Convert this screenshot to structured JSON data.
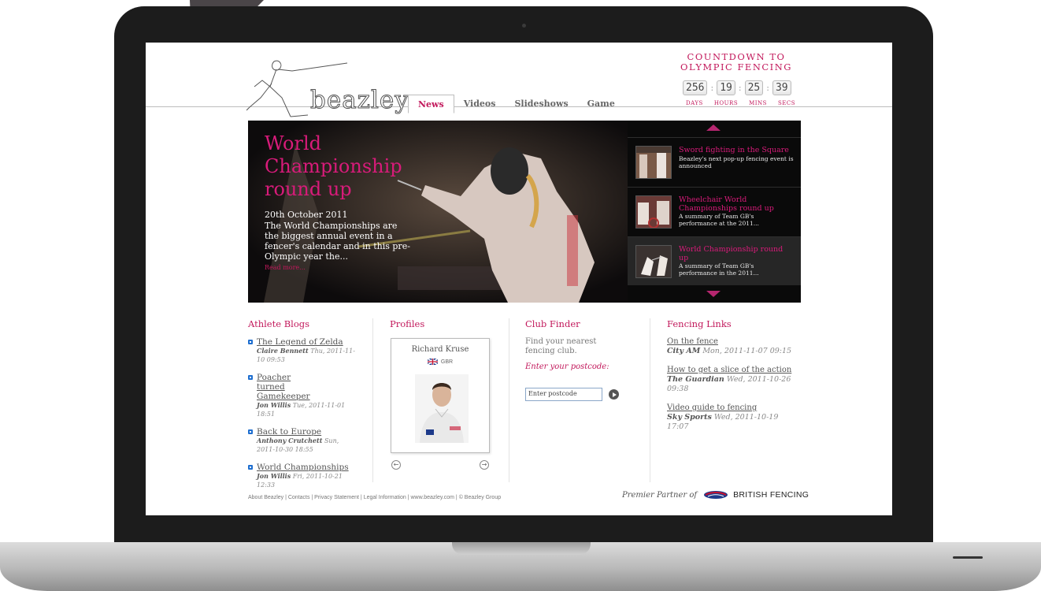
{
  "site": {
    "logo_text": "beazley",
    "nav": [
      {
        "label": "News",
        "active": true
      },
      {
        "label": "Videos",
        "active": false
      },
      {
        "label": "Slideshows",
        "active": false
      },
      {
        "label": "Game",
        "active": false
      }
    ],
    "accent_color": "#c2185b"
  },
  "countdown": {
    "title_line1": "COUNTDOWN TO",
    "title_line2": "OLYMPIC FENCING",
    "days": "256",
    "hours": "19",
    "mins": "25",
    "secs": "39",
    "labels": {
      "days": "DAYS",
      "hours": "HOURS",
      "mins": "MINS",
      "secs": "SECS"
    }
  },
  "hero": {
    "title": "World Championship round up",
    "date": "20th October 2011",
    "text": "The World Championships are the biggest annual event in a fencer's calendar and in this pre-Olympic year the...",
    "read_more": "Read more...",
    "list": [
      {
        "title": "Sword fighting in the Square",
        "desc": "Beazley's next pop-up fencing event is announced"
      },
      {
        "title": "Wheelchair World Championships round up",
        "desc": "A summary of Team GB's performance at the 2011..."
      },
      {
        "title": "World Championship round up",
        "desc": "A summary of Team GB's performance in the 2011..."
      }
    ]
  },
  "athlete_blogs": {
    "heading": "Athlete Blogs",
    "items": [
      {
        "title": "The Legend of Zelda",
        "author": "Claire Bennett",
        "date": "Thu, 2011-11-10 09:53"
      },
      {
        "title": "Poacher turned Gamekeeper",
        "author": "Jon Willis",
        "date": "Tue, 2011-11-01 18:51"
      },
      {
        "title": "Back to Europe",
        "author": "Anthony Crutchett",
        "date": "Sun, 2011-10-30 18:55"
      },
      {
        "title": "World Championships",
        "author": "Jon Willis",
        "date": "Fri, 2011-10-21 12:33"
      }
    ]
  },
  "profiles": {
    "heading": "Profiles",
    "name": "Richard Kruse",
    "country": "GBR",
    "prev_icon": "left-arrow-circle-icon",
    "next_icon": "right-arrow-circle-icon"
  },
  "club_finder": {
    "heading": "Club Finder",
    "text": "Find your nearest fencing club.",
    "prompt": "Enter your postcode:",
    "input_value": "Enter postcode"
  },
  "fencing_links": {
    "heading": "Fencing Links",
    "items": [
      {
        "title": "On the fence",
        "source": "City AM",
        "date": "Mon, 2011-11-07 09:15"
      },
      {
        "title": "How to get a slice of the action",
        "source": "The Guardian",
        "date": "Wed, 2011-10-26 09:38"
      },
      {
        "title": "Video guide to fencing",
        "source": "Sky Sports",
        "date": "Wed, 2011-10-19 17:07"
      }
    ]
  },
  "footer": {
    "links": "About Beazley | Contacts | Privacy Statement | Legal Information | www.beazley.com | © Beazley Group",
    "partner_text": "Premier Partner of",
    "partner_name": "BRITISH FENCING"
  }
}
